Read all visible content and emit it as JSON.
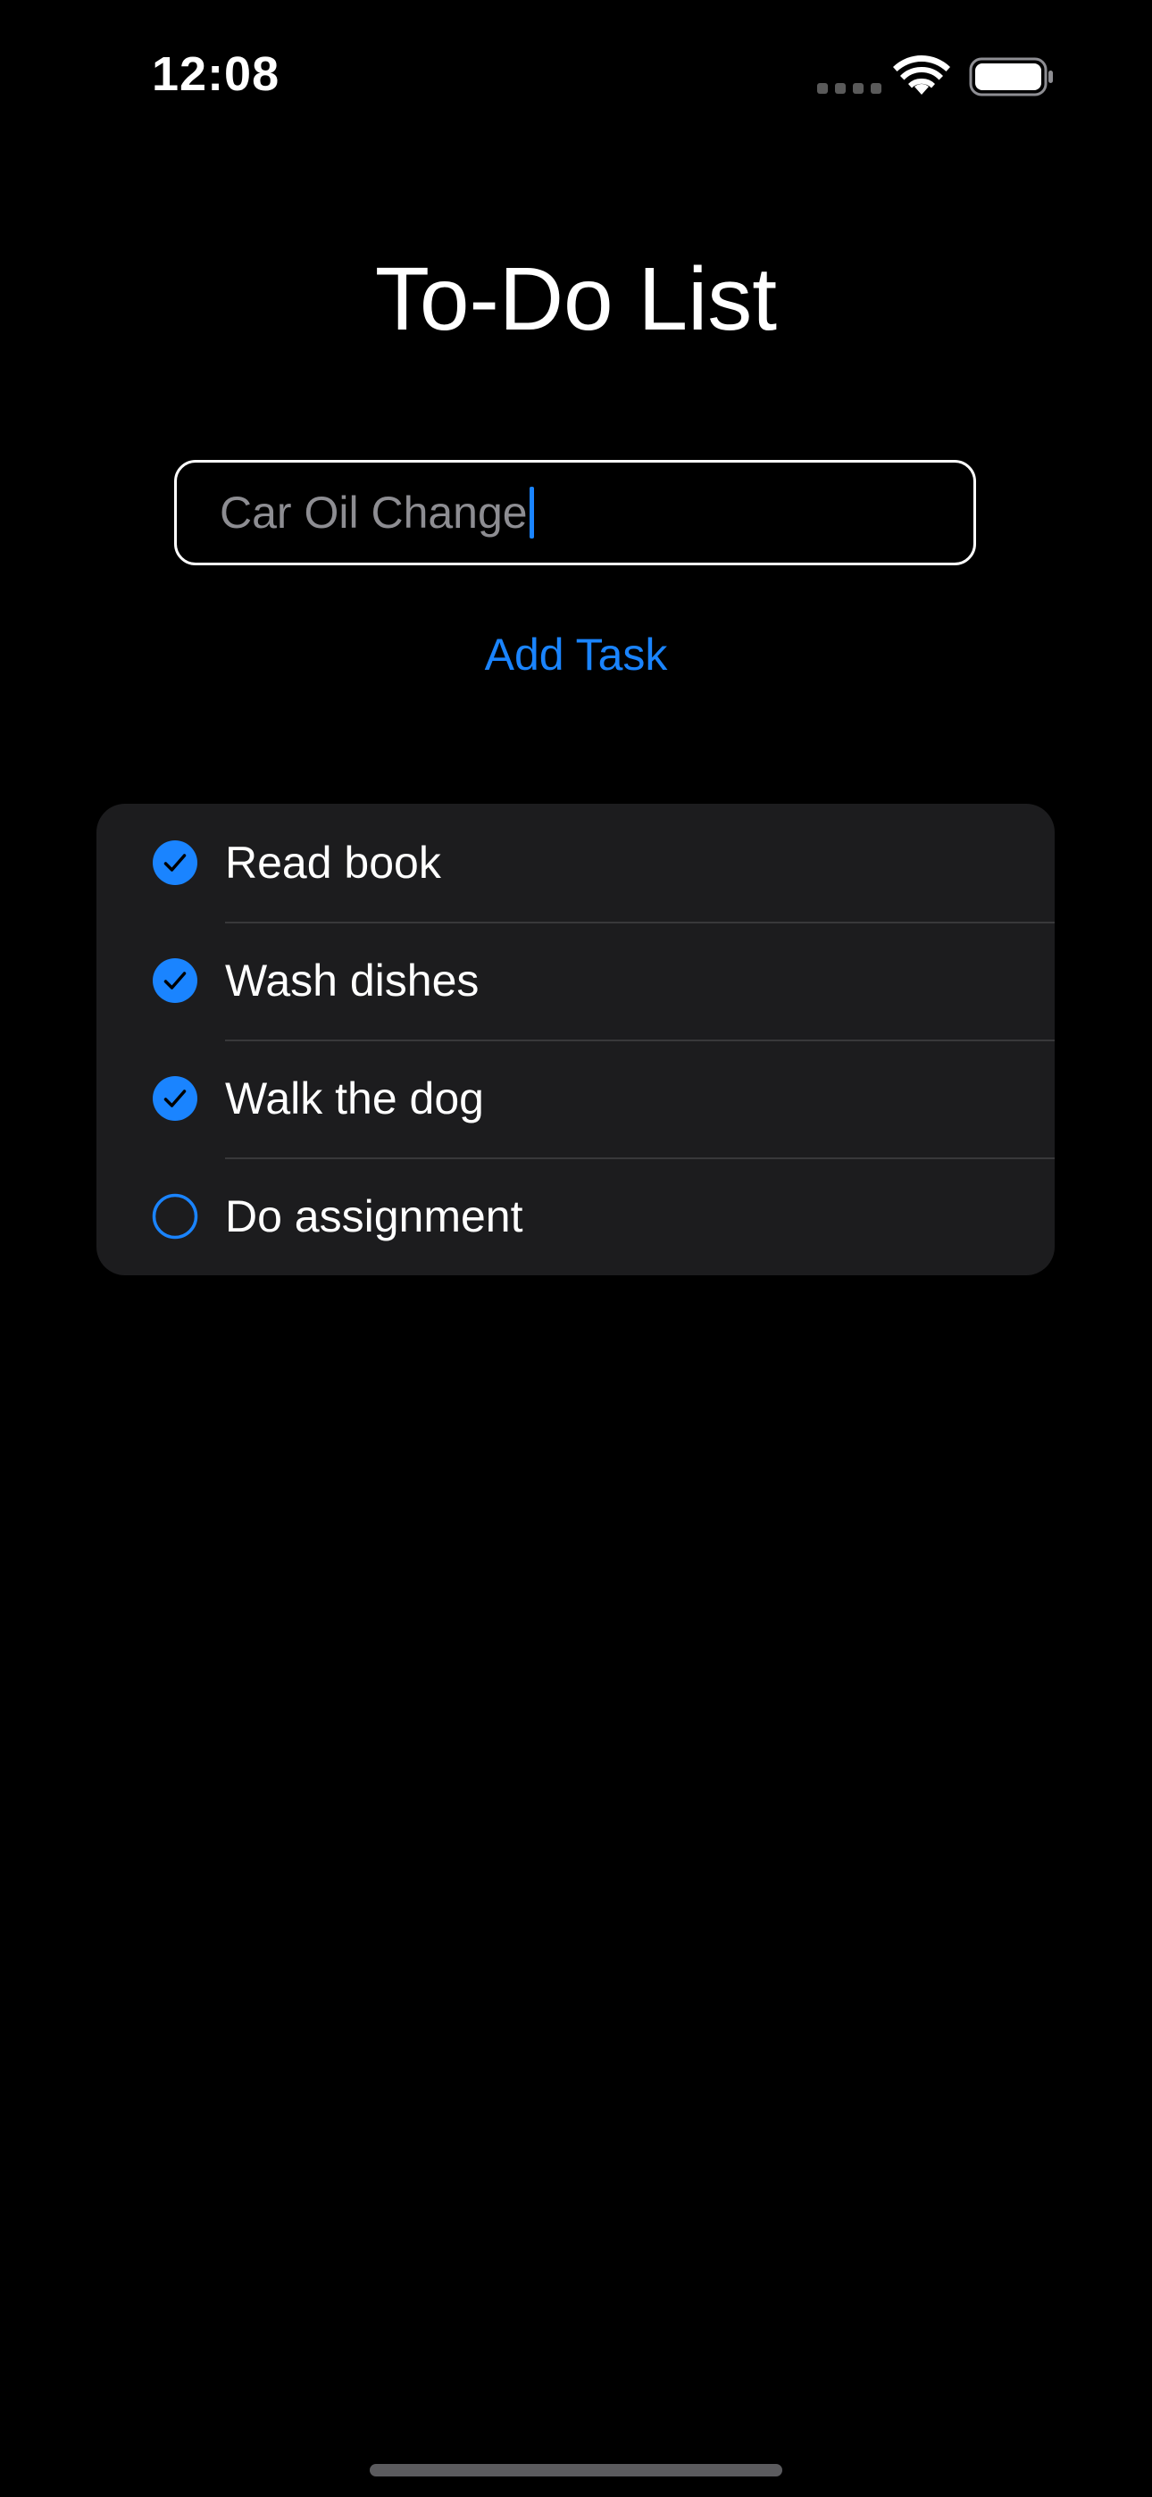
{
  "status_bar": {
    "time": "12:08",
    "icons": [
      "signal-dots-icon",
      "wifi-icon",
      "battery-icon"
    ]
  },
  "header": {
    "title": "To-Do List"
  },
  "input": {
    "value": "Car Oil Change",
    "text_color": "#8d8d92",
    "cursor_color": "#1a84ff"
  },
  "add_button": {
    "label": "Add Task",
    "color": "#1a84ff"
  },
  "tasks": [
    {
      "label": "Read book",
      "completed": true
    },
    {
      "label": "Wash dishes",
      "completed": true
    },
    {
      "label": "Walk the dog",
      "completed": true
    },
    {
      "label": "Do assignment",
      "completed": false
    }
  ],
  "colors": {
    "background": "#000000",
    "list_background": "#1c1c1e",
    "separator": "#38383a",
    "accent": "#1a84ff",
    "text": "#ffffff"
  }
}
